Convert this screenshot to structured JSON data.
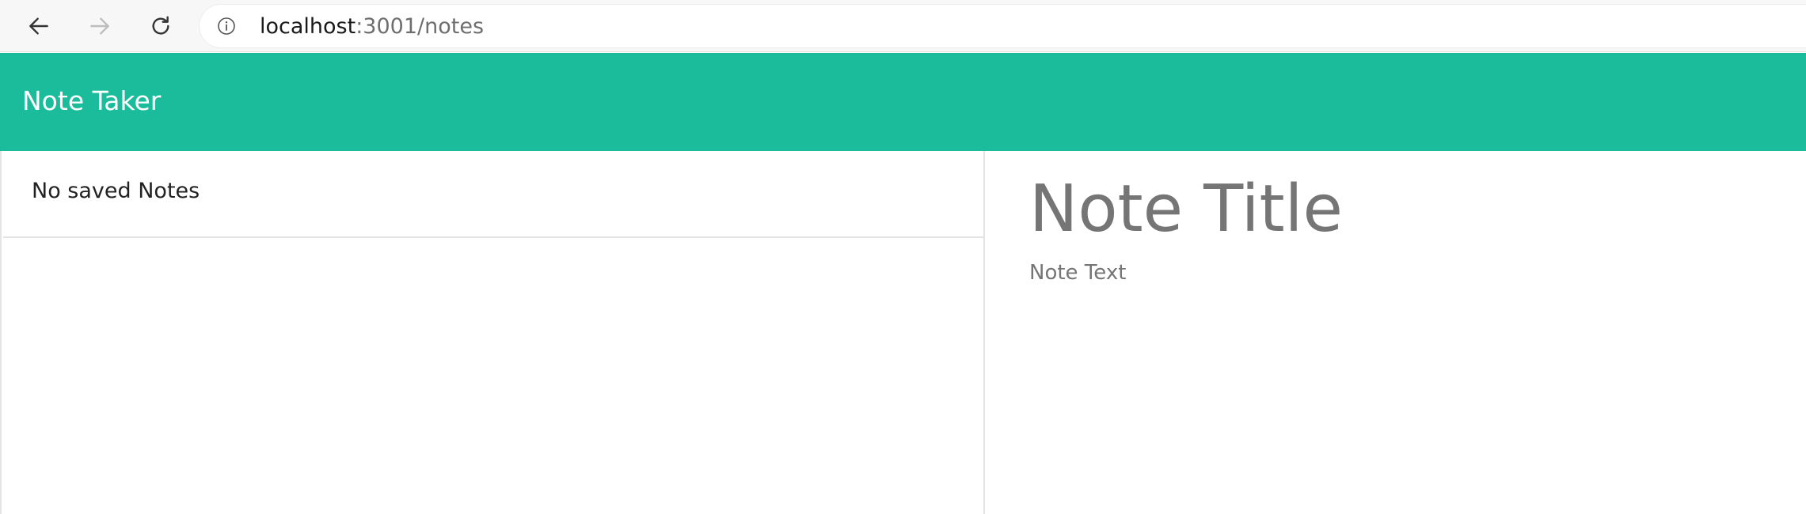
{
  "browser": {
    "url_host": "localhost",
    "url_rest": ":3001/notes"
  },
  "app": {
    "title": "Note Taker"
  },
  "sidebar": {
    "empty_label": "No saved Notes"
  },
  "editor": {
    "title_text": "Note Title",
    "body_text": "Note Text"
  },
  "colors": {
    "header_bg": "#1abc9c",
    "text_muted": "#707070"
  },
  "icons": {
    "back": "arrow-left-icon",
    "forward": "arrow-right-icon",
    "reload": "refresh-icon",
    "info": "info-icon"
  }
}
